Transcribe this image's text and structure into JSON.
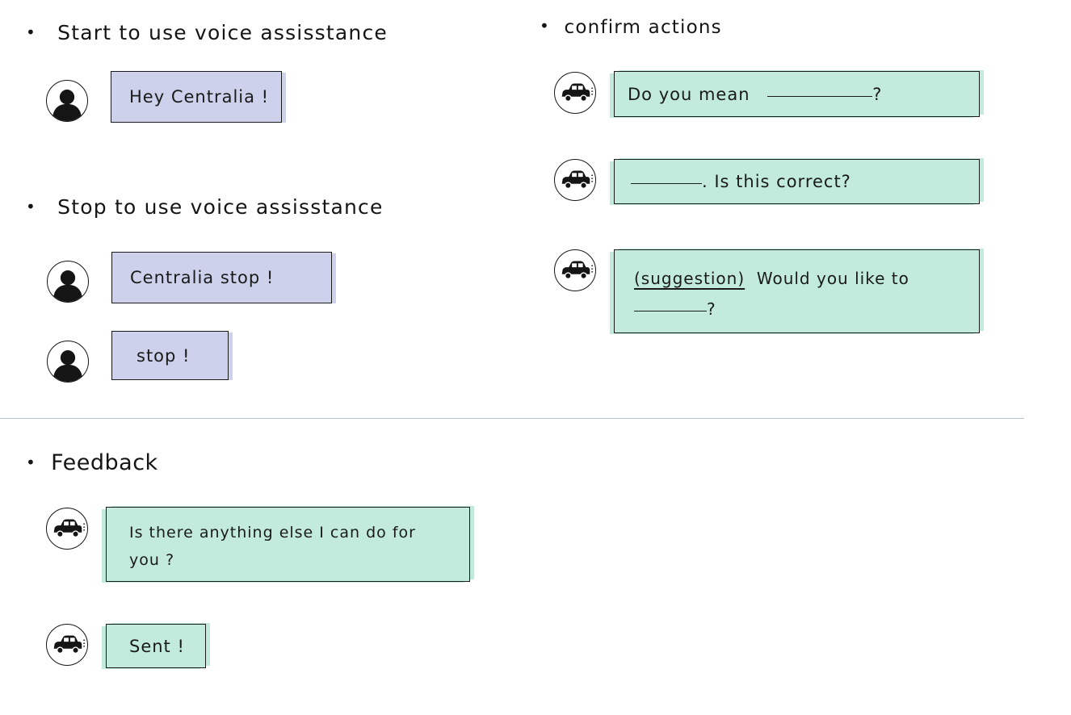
{
  "sections": {
    "start": {
      "heading": "Start to use voice assisstance",
      "messages": {
        "hey": "Hey Centralia !"
      }
    },
    "stop": {
      "heading": "Stop to use voice assisstance",
      "messages": {
        "centralia_stop": "Centralia stop !",
        "stop": "stop !"
      }
    },
    "confirm": {
      "heading": "confirm actions",
      "messages": {
        "do_you_mean_prefix": "Do you mean",
        "do_you_mean_suffix": "?",
        "is_correct_suffix": ". Is this correct?",
        "suggestion": "(suggestion)",
        "would_you_like": "Would you like to",
        "would_you_like_suffix": "?"
      }
    },
    "feedback": {
      "heading": "Feedback",
      "messages": {
        "anything_else": "Is there anything else I can do for you ?",
        "sent": "Sent !"
      }
    }
  },
  "icons": {
    "user": "user-avatar-icon",
    "assistant": "car-assistant-icon"
  },
  "colors": {
    "user_bubble": "#cdd1ec",
    "assistant_bubble": "#c2ebde",
    "divider": "#b7c3d2",
    "ink": "#151515"
  }
}
